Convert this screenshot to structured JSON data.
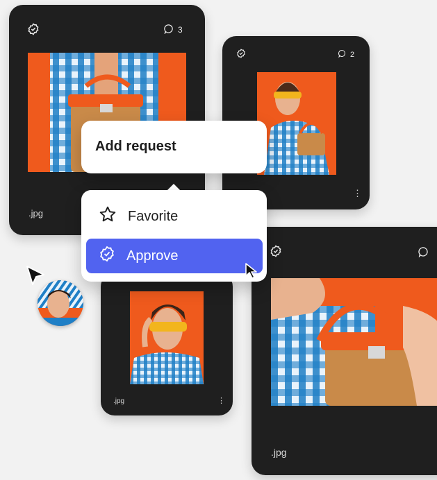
{
  "colors": {
    "card_bg": "#1f1f1f",
    "accent": "#5163f0",
    "photo_bg": "#ef5a1d"
  },
  "card1": {
    "comments": "3",
    "ext": ".jpg"
  },
  "card2": {
    "comments": "2"
  },
  "card3": {
    "ext": ".jpg"
  },
  "card4": {
    "ext": ".jpg"
  },
  "popup_request": {
    "title": "Add request"
  },
  "popup_menu": {
    "items": [
      {
        "label": "Favorite"
      },
      {
        "label": "Approve"
      }
    ]
  }
}
